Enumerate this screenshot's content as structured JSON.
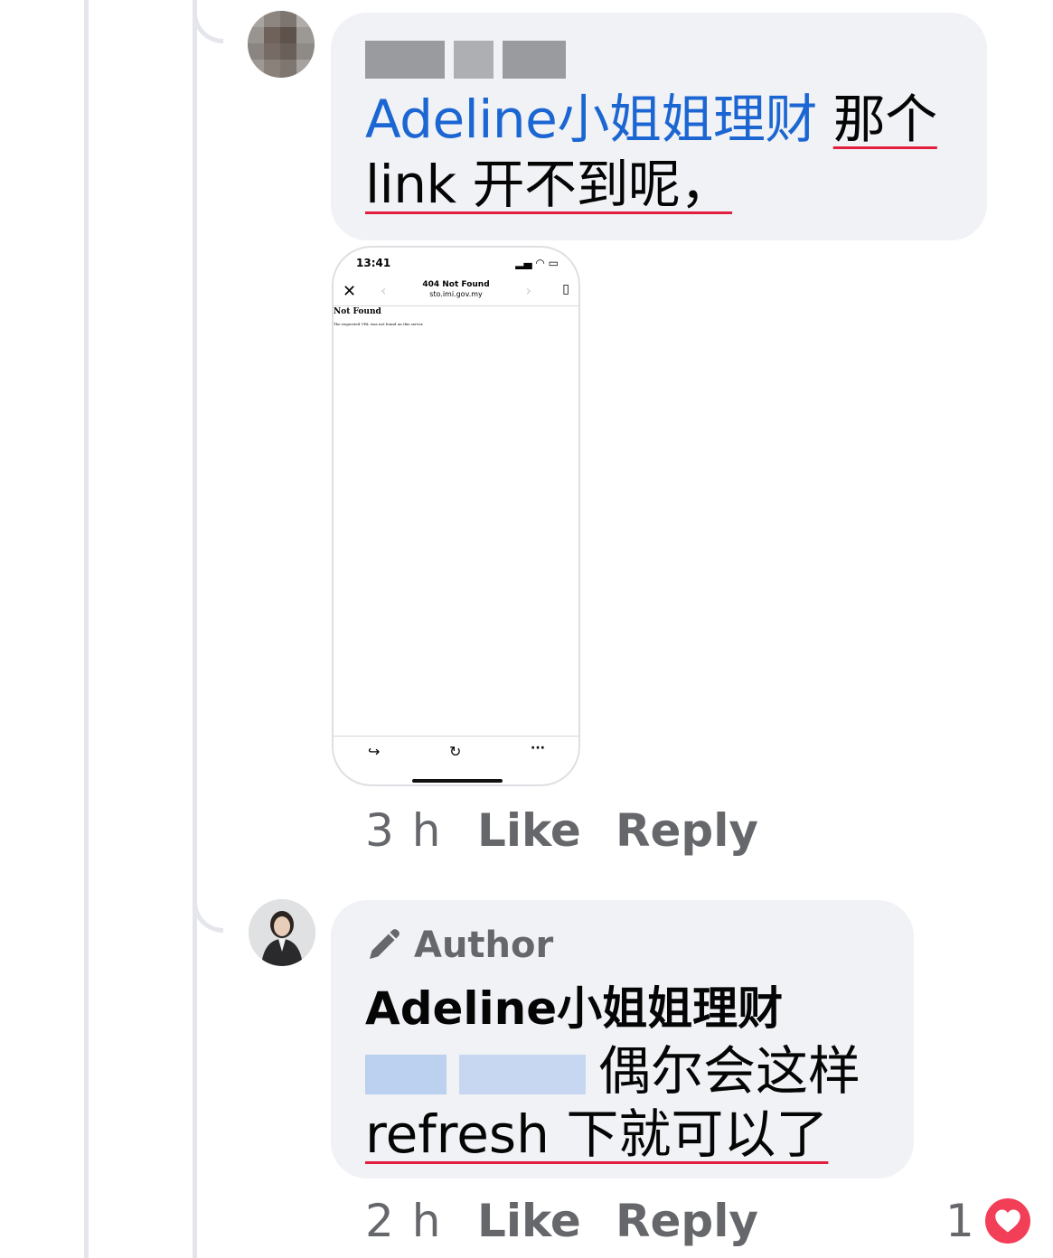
{
  "comment1": {
    "mention": "Adeline小姐姐理财",
    "text_line1": "那个",
    "text_line2": "link 开不到呢，",
    "attachment": {
      "status_time": "13:41",
      "page_title": "404 Not Found",
      "page_url": "sto.imi.gov.my",
      "heading": "Not Found",
      "message": "The requested URL was not found on this server."
    },
    "time": "3 h",
    "like": "Like",
    "reply": "Reply"
  },
  "comment2": {
    "badge": "Author",
    "author": "Adeline小姐姐理财",
    "text_line1": "偶尔会这样",
    "text_line2": "refresh 下就可以了",
    "time": "2 h",
    "like": "Like",
    "reply": "Reply",
    "reaction_count": "1",
    "reaction": "heart-icon"
  },
  "colors": {
    "bubble": "#f0f2f5",
    "mention": "#1b66d2",
    "secondary_text": "#65676b",
    "spell_underline": "#e41e3f",
    "heart": "#f33e58"
  }
}
